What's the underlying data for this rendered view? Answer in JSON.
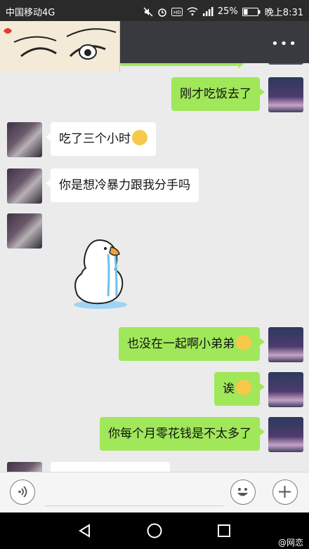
{
  "status_bar": {
    "carrier": "中国移动4G",
    "battery": "25%",
    "time": "晚上8:31",
    "icons": [
      "mute-icon",
      "alarm-icon",
      "hd-icon",
      "wifi-icon",
      "signal-icon",
      "battery-icon"
    ]
  },
  "titlebar": {
    "menu_icon": "more-dots-icon"
  },
  "messages": [
    {
      "side": "me",
      "text": "刚才吃饭去了"
    },
    {
      "side": "other",
      "text": "吃了三个小时",
      "emoji": "weary-emoji"
    },
    {
      "side": "other",
      "text": "你是想冷暴力跟我分手吗"
    },
    {
      "side": "other",
      "sticker": "crying-duck-sticker"
    },
    {
      "side": "me",
      "text": "也没在一起啊小弟弟",
      "emoji": "tears-of-joy-emoji"
    },
    {
      "side": "me",
      "text": "诶",
      "emoji": "flushed-emoji"
    },
    {
      "side": "me",
      "text": "你每个月零花钱是不太多了"
    }
  ],
  "input_bar": {
    "voice_icon": "voice-icon",
    "emoji_icon": "emoji-icon",
    "plus_icon": "plus-icon"
  },
  "nav_bar": {
    "icons": [
      "back-icon",
      "home-icon",
      "recents-icon"
    ]
  },
  "watermark": "@网恋"
}
